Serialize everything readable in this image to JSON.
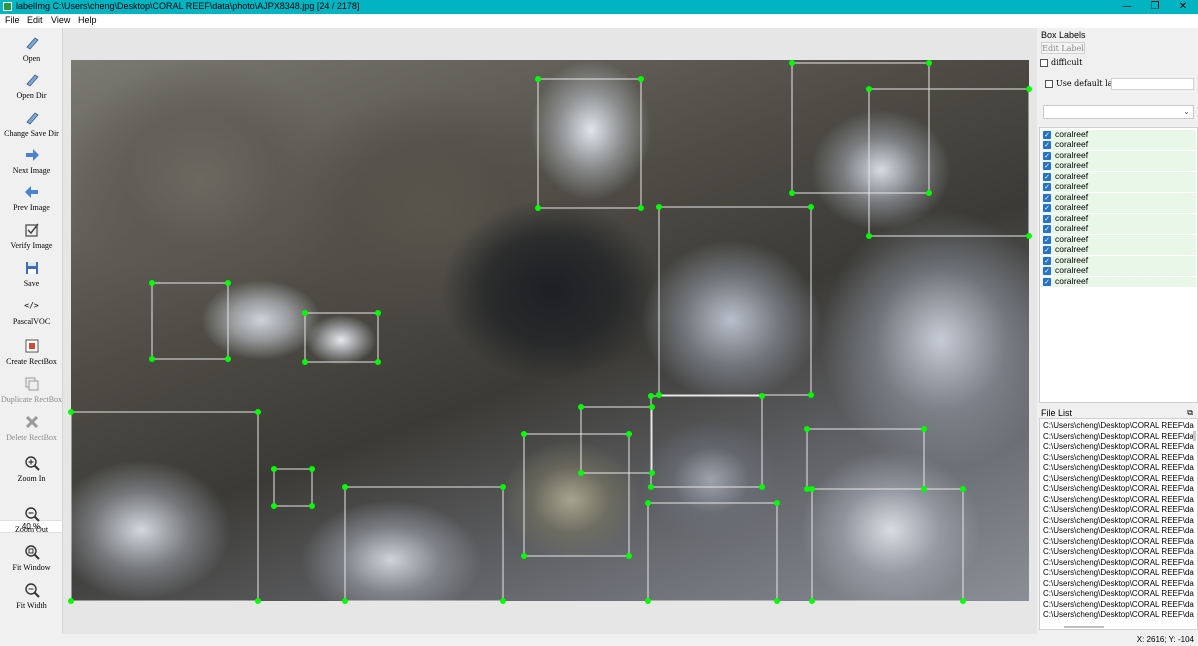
{
  "window": {
    "title": "labelImg C:\\Users\\cheng\\Desktop\\CORAL REEF\\data\\photo\\AJPX8348.jpg [24 / 2178]",
    "minimize_glyph": "—",
    "maximize_glyph": "❐",
    "close_glyph": "✕"
  },
  "menu": {
    "file": "File",
    "edit": "Edit",
    "view": "View",
    "help": "Help"
  },
  "toolbar": {
    "open": "Open",
    "open_dir": "Open Dir",
    "change_save_dir": "Change Save Dir",
    "next_image": "Next Image",
    "prev_image": "Prev Image",
    "verify_image": "Verify Image",
    "save": "Save",
    "format": "PascalVOC",
    "format_glyph": "</>",
    "create_rectbox": "Create RectBox",
    "duplicate_rectbox": "Duplicate RectBox",
    "delete_rectbox": "Delete RectBox",
    "zoom_in": "Zoom In",
    "zoom_value": "40 %",
    "zoom_out": "Zoom Out",
    "fit_window": "Fit Window",
    "fit_width": "Fit Width"
  },
  "box_labels_panel": {
    "title": "Box Labels",
    "edit_label": "Edit Label",
    "difficult": "difficult",
    "use_default_label": "Use default label",
    "default_label_value": "",
    "label_items": [
      "coralreef",
      "coralreef",
      "coralreef",
      "coralreef",
      "coralreef",
      "coralreef",
      "coralreef",
      "coralreef",
      "coralreef",
      "coralreef",
      "coralreef",
      "coralreef",
      "coralreef",
      "coralreef",
      "coralreef"
    ]
  },
  "file_list_panel": {
    "title": "File List",
    "files": [
      "C:\\Users\\cheng\\Desktop\\CORAL REEF\\da",
      "C:\\Users\\cheng\\Desktop\\CORAL REEF\\da",
      "C:\\Users\\cheng\\Desktop\\CORAL REEF\\da",
      "C:\\Users\\cheng\\Desktop\\CORAL REEF\\da",
      "C:\\Users\\cheng\\Desktop\\CORAL REEF\\da",
      "C:\\Users\\cheng\\Desktop\\CORAL REEF\\da",
      "C:\\Users\\cheng\\Desktop\\CORAL REEF\\da",
      "C:\\Users\\cheng\\Desktop\\CORAL REEF\\da",
      "C:\\Users\\cheng\\Desktop\\CORAL REEF\\da",
      "C:\\Users\\cheng\\Desktop\\CORAL REEF\\da",
      "C:\\Users\\cheng\\Desktop\\CORAL REEF\\da",
      "C:\\Users\\cheng\\Desktop\\CORAL REEF\\da",
      "C:\\Users\\cheng\\Desktop\\CORAL REEF\\da",
      "C:\\Users\\cheng\\Desktop\\CORAL REEF\\da",
      "C:\\Users\\cheng\\Desktop\\CORAL REEF\\da",
      "C:\\Users\\cheng\\Desktop\\CORAL REEF\\da",
      "C:\\Users\\cheng\\Desktop\\CORAL REEF\\da",
      "C:\\Users\\cheng\\Desktop\\CORAL REEF\\da",
      "C:\\Users\\cheng\\Desktop\\CORAL REEF\\da"
    ]
  },
  "status_bar": {
    "coords": "X: 2616; Y: -104"
  },
  "colors": {
    "titlebar": "#00b4c2",
    "box_outline": "#e6e6e6",
    "box_vertex": "#00ff00",
    "label_check": "#2870c8"
  }
}
